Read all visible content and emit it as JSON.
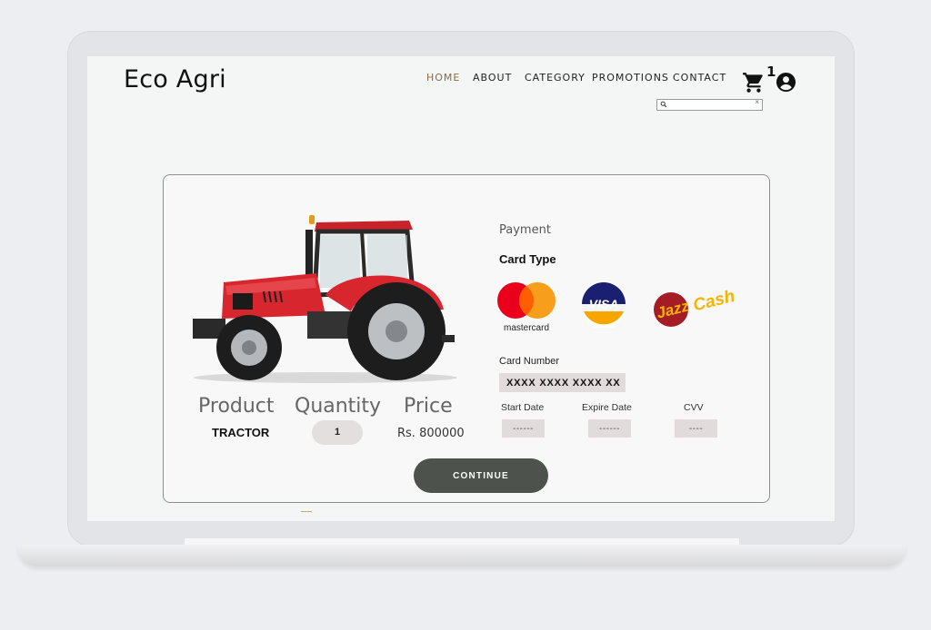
{
  "header": {
    "brand": "Eco Agri",
    "nav": [
      {
        "label": "HOME",
        "active": true
      },
      {
        "label": "ABOUT"
      },
      {
        "label": "CATEGORY"
      },
      {
        "label": "PROMOTIONS"
      },
      {
        "label": "CONTACT"
      }
    ],
    "cart_icon": "shopping-cart-icon",
    "cart_count": "1",
    "user_icon": "account-circle-icon",
    "search": {
      "value": "",
      "placeholder": "",
      "icon": "search-icon",
      "clear": "×"
    }
  },
  "order": {
    "columns": {
      "product": "Product",
      "quantity": "Quantity",
      "price": "Price"
    },
    "product": "TRACTOR",
    "quantity": "1",
    "price": "Rs. 800000",
    "image": "red-tractor"
  },
  "payment": {
    "title": "Payment",
    "card_type_label": "Card Type",
    "card_types": [
      {
        "name": "mastercard",
        "label": "mastercard"
      },
      {
        "name": "visa",
        "label": "VISA"
      },
      {
        "name": "jazzcash",
        "label_a": "Jazz",
        "label_b": "Cash"
      }
    ],
    "card_number_label": "Card Number",
    "card_number_value": "XXXX XXXX XXXX XX",
    "start_date_label": "Start Date",
    "start_date_value": "------",
    "expire_date_label": "Expire Date",
    "expire_date_value": "------",
    "cvv_label": "CVV",
    "cvv_value": "----",
    "continue_label": "CONTINUE"
  },
  "colors": {
    "active_nav": "#8b6a3e",
    "continue_button": "#4d534c",
    "field_bg": "#e1dcdb",
    "tractor_red": "#d8262f"
  }
}
